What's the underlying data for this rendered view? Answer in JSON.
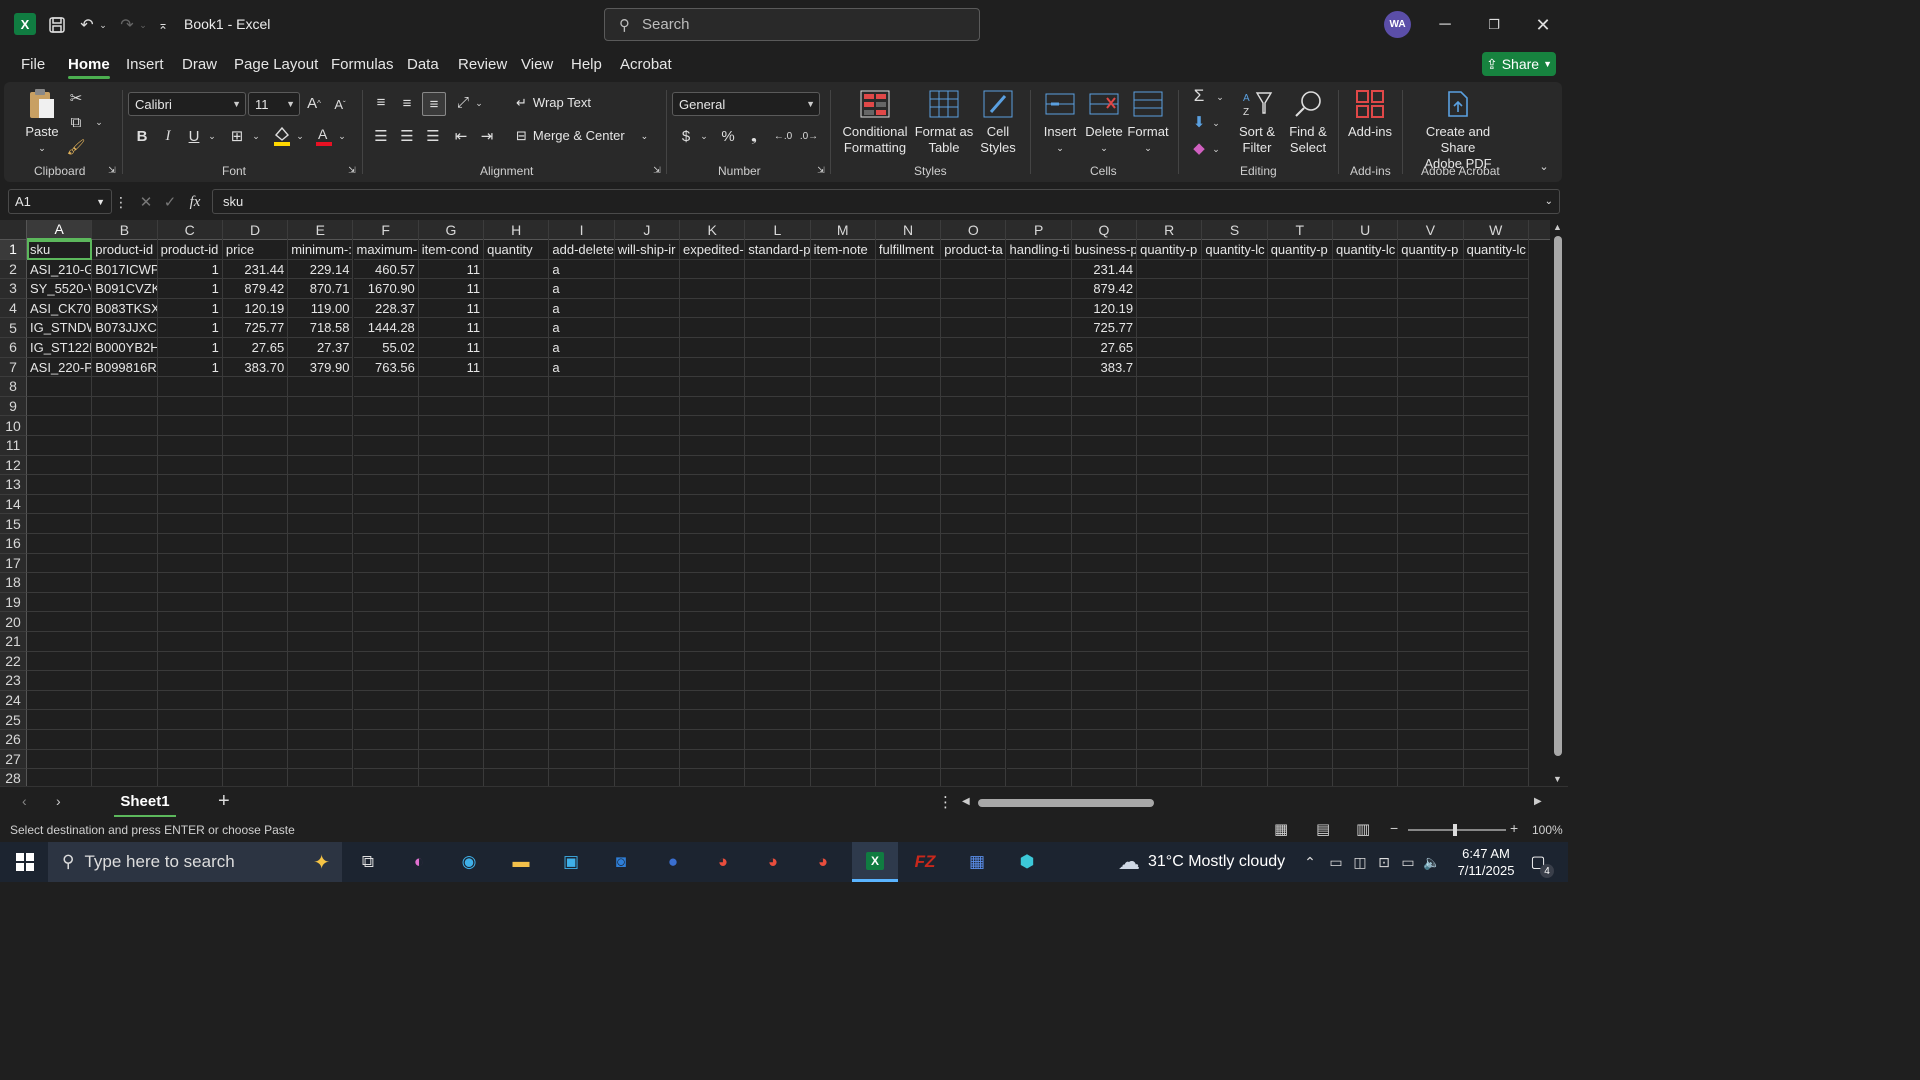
{
  "app": {
    "title": "Book1  -  Excel",
    "logo": "X",
    "search_placeholder": "Search",
    "user_initials": "WA",
    "share_label": "Share"
  },
  "menu": {
    "tabs": [
      "File",
      "Home",
      "Insert",
      "Draw",
      "Page Layout",
      "Formulas",
      "Data",
      "Review",
      "View",
      "Help",
      "Acrobat"
    ],
    "active": "Home"
  },
  "ribbon": {
    "clipboard": {
      "paste": "Paste",
      "group": "Clipboard"
    },
    "font": {
      "name": "Calibri",
      "size": "11",
      "group": "Font"
    },
    "alignment": {
      "wrap": "Wrap Text",
      "merge": "Merge & Center",
      "group": "Alignment"
    },
    "number": {
      "format": "General",
      "group": "Number"
    },
    "styles": {
      "conditional": "Conditional",
      "conditional2": "Formatting",
      "format_table": "Format as",
      "format_table2": "Table",
      "cell_styles": "Cell",
      "cell_styles2": "Styles",
      "group": "Styles"
    },
    "cells": {
      "insert": "Insert",
      "delete": "Delete",
      "format": "Format",
      "group": "Cells"
    },
    "editing": {
      "sort": "Sort &",
      "sort2": "Filter",
      "find": "Find &",
      "find2": "Select",
      "group": "Editing"
    },
    "addins": {
      "label": "Add-ins",
      "group": "Add-ins"
    },
    "acrobat": {
      "label": "Create and Share",
      "label2": "Adobe PDF",
      "group": "Adobe Acrobat"
    }
  },
  "formula_bar": {
    "name_box": "A1",
    "fx": "fx",
    "content": "sku"
  },
  "sheet": {
    "columns": [
      "A",
      "B",
      "C",
      "D",
      "E",
      "F",
      "G",
      "H",
      "I",
      "J",
      "K",
      "L",
      "M",
      "N",
      "O",
      "P",
      "Q",
      "R",
      "S",
      "T",
      "U",
      "V",
      "W"
    ],
    "headers": [
      "sku",
      "product-id",
      "product-id",
      "price",
      "minimum-:",
      "maximum-",
      "item-cond",
      "quantity",
      "add-delete",
      "will-ship-ir",
      "expedited-",
      "standard-p",
      "item-note",
      "fulfillment",
      "product-ta",
      "handling-ti",
      "business-p",
      "quantity-p",
      "quantity-lc",
      "quantity-p",
      "quantity-lc",
      "quantity-p",
      "quantity-lc"
    ],
    "rows": [
      [
        "ASI_210-G",
        "B017ICWP",
        "1",
        "231.44",
        "229.14",
        "460.57",
        "11",
        "",
        "a",
        "",
        "",
        "",
        "",
        "",
        "",
        "",
        "231.44"
      ],
      [
        "SY_5520-V",
        "B091CVZK5",
        "1",
        "879.42",
        "870.71",
        "1670.90",
        "11",
        "",
        "a",
        "",
        "",
        "",
        "",
        "",
        "",
        "",
        "879.42"
      ],
      [
        "ASI_CK709",
        "B083TKSX3",
        "1",
        "120.19",
        "119.00",
        "228.37",
        "11",
        "",
        "a",
        "",
        "",
        "",
        "",
        "",
        "",
        "",
        "120.19"
      ],
      [
        "IG_STNDW",
        "B073JJXCH",
        "1",
        "725.77",
        "718.58",
        "1444.28",
        "11",
        "",
        "a",
        "",
        "",
        "",
        "",
        "",
        "",
        "",
        "725.77"
      ],
      [
        "IG_ST122L",
        "B000YB2H",
        "1",
        "27.65",
        "27.37",
        "55.02",
        "11",
        "",
        "a",
        "",
        "",
        "",
        "",
        "",
        "",
        "",
        "27.65"
      ],
      [
        "ASI_220-PI",
        "B099816R9",
        "1",
        "383.70",
        "379.90",
        "763.56",
        "11",
        "",
        "a",
        "",
        "",
        "",
        "",
        "",
        "",
        "",
        "383.7"
      ]
    ],
    "row_numbers": [
      "1",
      "2",
      "3",
      "4",
      "5",
      "6",
      "7",
      "8",
      "9",
      "10",
      "11",
      "12",
      "13",
      "14",
      "15",
      "16",
      "17",
      "18",
      "19",
      "20",
      "21",
      "22",
      "23",
      "24",
      "25",
      "26",
      "27",
      "28"
    ],
    "tab_name": "Sheet1"
  },
  "status": {
    "message": "Select destination and press ENTER or choose Paste",
    "zoom": "100%"
  },
  "taskbar": {
    "search": "Type here to search",
    "weather": "31°C  Mostly cloudy",
    "time": "6:47 AM",
    "date": "7/11/2025",
    "notif_count": "4"
  },
  "colors": {
    "accent": "#107c41",
    "selection": "#5cb85c",
    "background": "#1f1f1f"
  }
}
